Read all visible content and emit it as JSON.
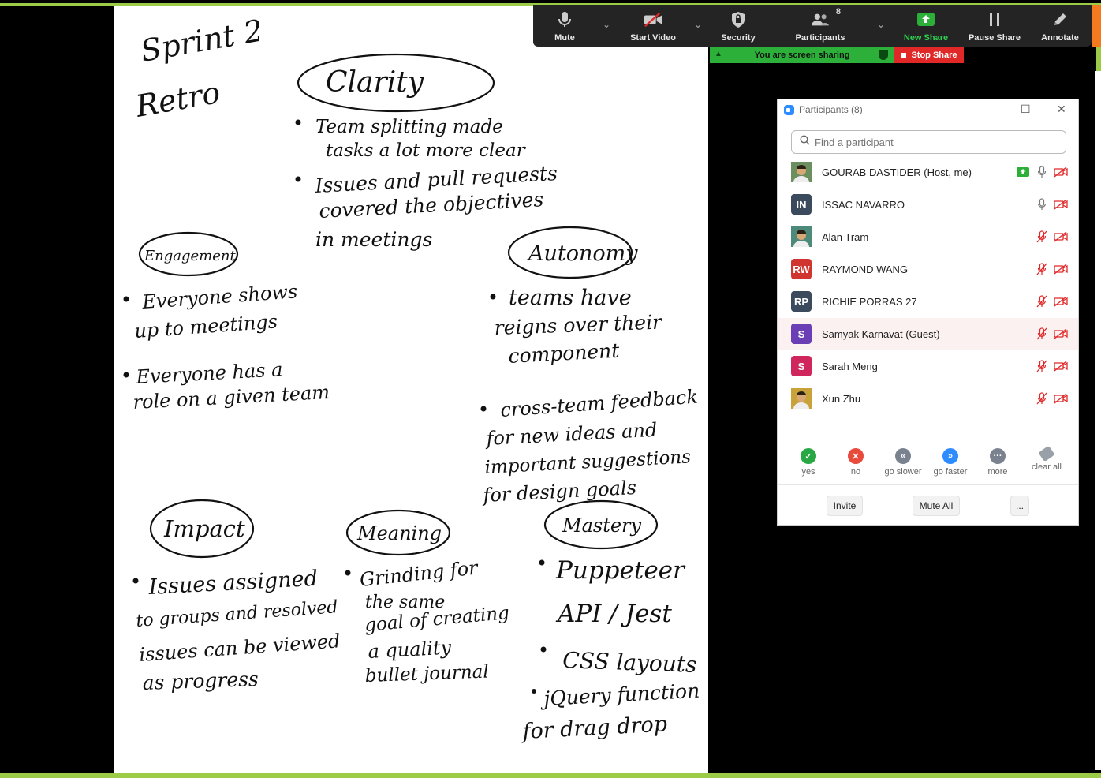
{
  "toolbar": {
    "mute": "Mute",
    "start_video": "Start Video",
    "security": "Security",
    "participants": "Participants",
    "participants_count": "8",
    "new_share": "New Share",
    "pause_share": "Pause Share",
    "annotate": "Annotate"
  },
  "share_bar": {
    "status": "You are screen sharing",
    "stop": "Stop Share"
  },
  "panel": {
    "title": "Participants (8)",
    "search_placeholder": "Find a participant",
    "participants": [
      {
        "name": "GOURAB DASTIDER (Host, me)",
        "initials": "",
        "avatar_color": "#6b8f5e",
        "photo": true
      },
      {
        "name": "ISSAC NAVARRO",
        "initials": "IN",
        "avatar_color": "#3b4a5c",
        "photo": false
      },
      {
        "name": "Alan Tram",
        "initials": "",
        "avatar_color": "#4d8a7a",
        "photo": true
      },
      {
        "name": "RAYMOND WANG",
        "initials": "RW",
        "avatar_color": "#d0362f",
        "photo": false
      },
      {
        "name": "RICHIE PORRAS 27",
        "initials": "RP",
        "avatar_color": "#3b4a5c",
        "photo": false
      },
      {
        "name": "Samyak Karnavat (Guest)",
        "initials": "S",
        "avatar_color": "#6a3fb5",
        "photo": false
      },
      {
        "name": "Sarah Meng",
        "initials": "S",
        "avatar_color": "#d0265e",
        "photo": false
      },
      {
        "name": "Xun Zhu",
        "initials": "",
        "avatar_color": "#c9a23a",
        "photo": true
      }
    ],
    "reactions": [
      {
        "label": "yes",
        "color": "#27a845",
        "glyph": "✓"
      },
      {
        "label": "no",
        "color": "#e84a3c",
        "glyph": "✕"
      },
      {
        "label": "go slower",
        "color": "#7a8290",
        "glyph": "«"
      },
      {
        "label": "go faster",
        "color": "#2d8cff",
        "glyph": "»"
      },
      {
        "label": "more",
        "color": "#7a8290",
        "glyph": "···"
      },
      {
        "label": "clear all",
        "color": "#9aa0a8",
        "glyph": ""
      }
    ],
    "invite": "Invite",
    "mute_all": "Mute All",
    "more": "..."
  },
  "whiteboard": {
    "title_line1": "Sprint 2",
    "title_line2": "Retro",
    "sections": {
      "clarity": "Clarity",
      "engagement": "Engagement",
      "autonomy": "Autonomy",
      "impact": "Impact",
      "meaning": "Meaning",
      "mastery": "Mastery"
    },
    "notes": {
      "c1a": "Team splitting made",
      "c1b": "tasks a lot more clear",
      "c2a": "Issues and pull requests",
      "c2b": "covered the objectives",
      "c2c": "in meetings",
      "e1a": "Everyone shows",
      "e1b": "up to meetings",
      "e2a": "Everyone has a",
      "e2b": "role on a given team",
      "a1a": "teams have",
      "a1b": "reigns over their",
      "a1c": "component",
      "a2a": "cross-team feedback",
      "a2b": "for new ideas and",
      "a2c": "important suggestions",
      "a2d": "for design goals",
      "i1a": "Issues assigned",
      "i1b": "to groups and resolved",
      "i1c": "issues can be viewed",
      "i1d": "as progress",
      "m1a": "Grinding for",
      "m1b": "the same",
      "m1c": "goal of creating",
      "m1d": "a quality",
      "m1e": "bullet journal",
      "ms1a": "Puppeteer",
      "ms1b": "API / Jest",
      "ms2": "CSS layouts",
      "ms3a": "jQuery function",
      "ms3b": "for drag drop"
    }
  }
}
